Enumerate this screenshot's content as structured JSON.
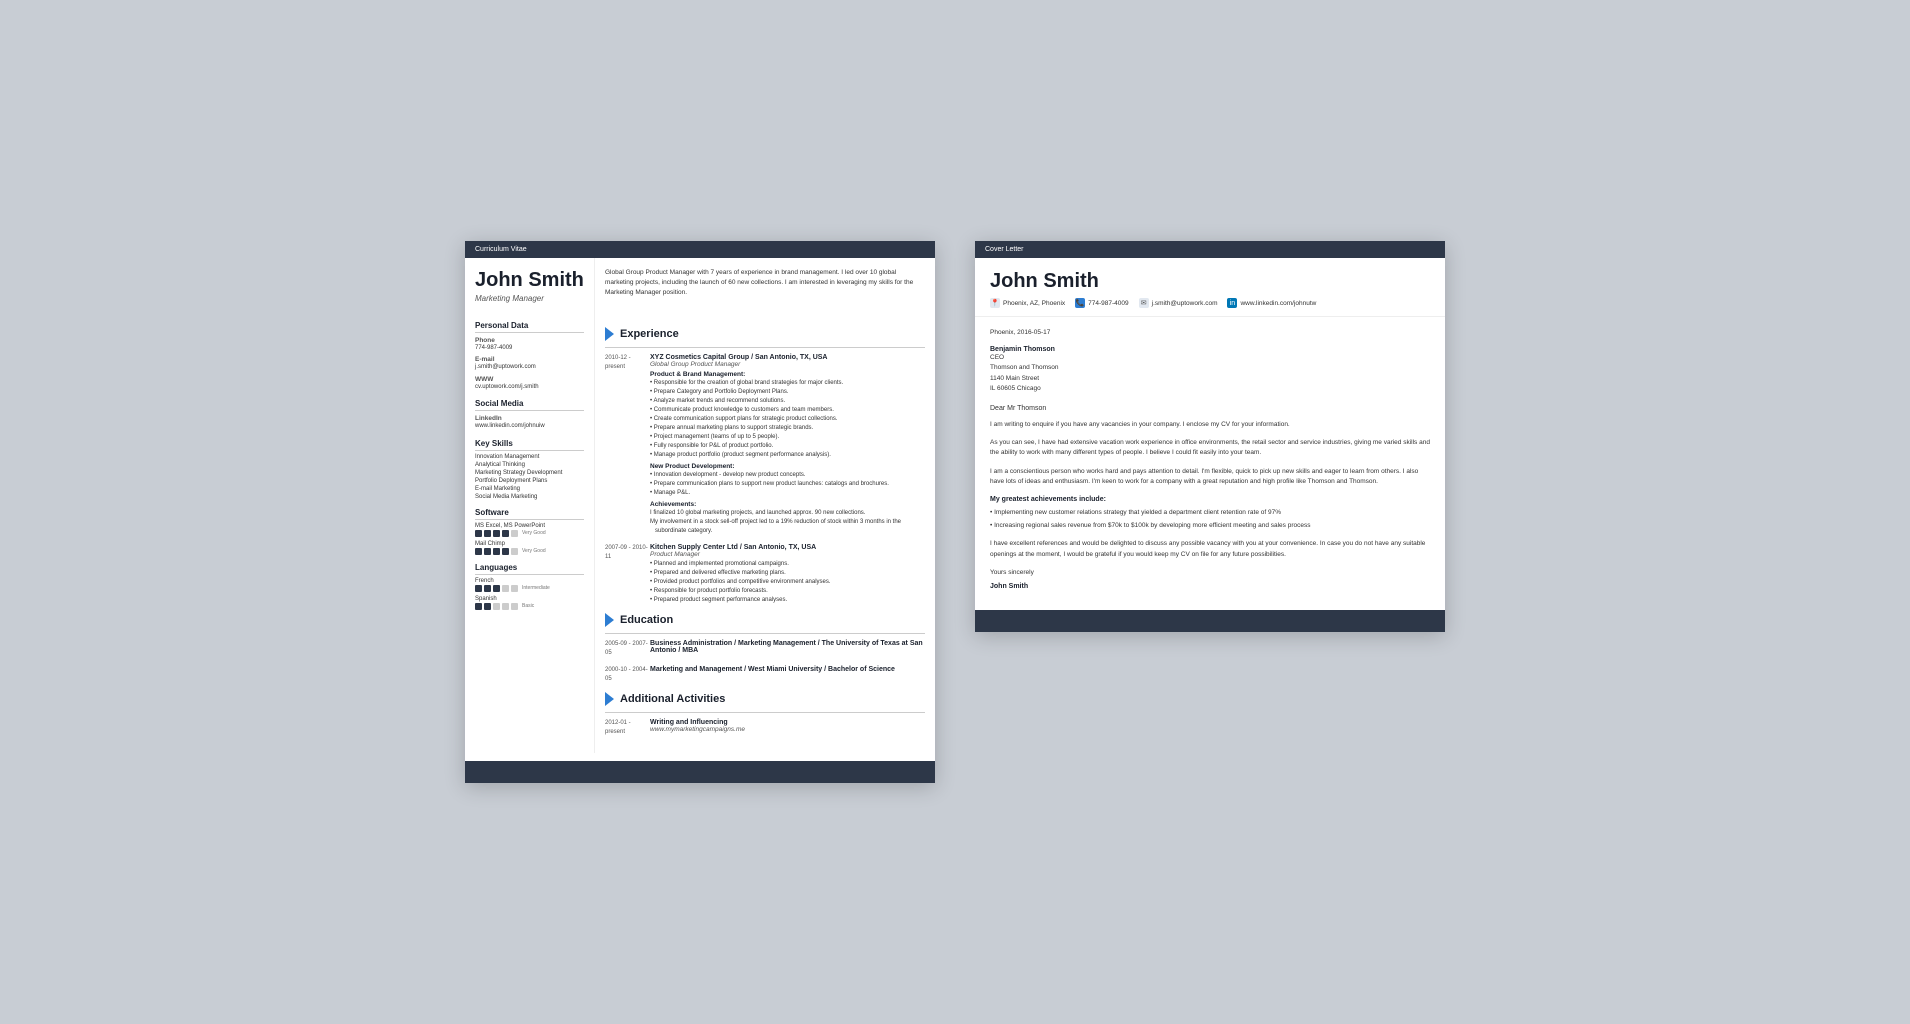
{
  "cv": {
    "header_bar": "Curriculum Vitae",
    "name": "John Smith",
    "title": "Marketing Manager",
    "summary": "Global Group Product Manager with 7 years of experience in brand management. I led over 10 global marketing projects, including the launch of 60 new collections. I am interested in leveraging my skills for the Marketing Manager position.",
    "sections": {
      "personal_data": "Personal Data",
      "phone_label": "Phone",
      "phone": "774-987-4009",
      "email_label": "E-mail",
      "email": "j.smith@uptowork.com",
      "www_label": "WWW",
      "www": "cv.uptowork.com/j.smith",
      "social_media": "Social Media",
      "linkedin_label": "LinkedIn",
      "linkedin": "www.linkedin.com/johnuiw",
      "key_skills": "Key Skills",
      "skills": [
        "Innovation Management",
        "Analytical Thinking",
        "Marketing Strategy Development",
        "Portfolio Deployment Plans",
        "E-mail Marketing",
        "Social Media Marketing"
      ],
      "software": "Software",
      "software_items": [
        {
          "name": "MS Excel, MS PowerPoint",
          "level": 4,
          "label": "Very Good"
        },
        {
          "name": "Mail Chimp",
          "level": 4,
          "label": "Very Good"
        }
      ],
      "languages": "Languages",
      "lang_items": [
        {
          "name": "French",
          "level": 3,
          "label": "Intermediate"
        },
        {
          "name": "Spanish",
          "level": 2,
          "label": "Basic"
        }
      ]
    },
    "experience_title": "Experience",
    "experience": [
      {
        "date": "2010-12 - present",
        "company": "XYZ Cosmetics Capital Group / San Antonio, TX, USA",
        "position": "Global Group Product Manager",
        "subsections": [
          {
            "title": "Product & Brand Management:",
            "bullets": [
              "Responsible for the creation of global brand strategies for major clients.",
              "Prepare Category and Portfolio Deployment Plans.",
              "Analyze market trends and recommend solutions.",
              "Communicate product knowledge to customers and team members.",
              "Create communication support plans for strategic product collections.",
              "Prepare annual marketing plans to support strategic brands.",
              "Project management (teams of up to 5 people).",
              "Fully responsible for P&L of product portfolio.",
              "Manage product portfolio (product segment performance analysis)."
            ]
          },
          {
            "title": "New Product Development:",
            "bullets": [
              "Innovation development - develop new product concepts.",
              "Prepare communication plans to support new product launches: catalogs and brochures.",
              "Manage P&L."
            ]
          },
          {
            "title": "Achievements:",
            "bullets": [
              "I finalized 10 global marketing projects, and launched approx. 90 new collections.",
              "My involvement in a stock sell-off project led to a 19% reduction of stock within 3 months in the subordinate category."
            ]
          }
        ]
      },
      {
        "date": "2007-09 - 2010-11",
        "company": "Kitchen Supply Center Ltd / San Antonio, TX, USA",
        "position": "Product Manager",
        "subsections": [
          {
            "title": "",
            "bullets": [
              "Planned and implemented promotional campaigns.",
              "Prepared and delivered effective marketing plans.",
              "Provided product portfolios and competitive environment analyses.",
              "Responsible for product portfolio forecasts.",
              "Prepared product segment performance analyses."
            ]
          }
        ]
      }
    ],
    "education_title": "Education",
    "education": [
      {
        "date": "2005-09 - 2007-05",
        "title": "Business Administration / Marketing Management / The University of Texas at San Antonio / MBA"
      },
      {
        "date": "2000-10 - 2004-05",
        "title": "Marketing and Management / West Miami University / Bachelor of Science"
      }
    ],
    "activities_title": "Additional Activities",
    "activities": [
      {
        "date": "2012-01 - present",
        "title": "Writing and Influencing",
        "detail": "www.mymarketingcampaigns.me"
      }
    ]
  },
  "cover_letter": {
    "header_bar": "Cover Letter",
    "name": "John Smith",
    "contact": {
      "location": "Phoenix, AZ, Phoenix",
      "phone": "774-987-4009",
      "email": "j.smith@uptowork.com",
      "linkedin": "www.linkedin.com/johnutw"
    },
    "date": "Phoenix, 2016-05-17",
    "recipient": {
      "name": "Benjamin Thomson",
      "title": "CEO",
      "company": "Thomson and Thomson",
      "address": "1140 Main Street",
      "city": "IL 60605 Chicago"
    },
    "salutation": "Dear Mr Thomson",
    "paragraphs": [
      "I am writing to enquire if you have any vacancies in your company. I enclose my CV for your information.",
      "As you can see, I have had extensive vacation work experience in office environments, the retail sector and service industries, giving me varied skills and the ability to work with many different types of people. I believe I could fit easily into your team.",
      "I am a conscientious person who works hard and pays attention to detail. I'm flexible, quick to pick up new skills and eager to learn from others. I also have lots of ideas and enthusiasm. I'm keen to work for a company with a great reputation and high profile like Thomson and Thomson."
    ],
    "achievements_title": "My greatest achievements include:",
    "achievements": [
      "Implementing new customer relations strategy that yielded a department client retention rate of 97%",
      "Increasing regional sales revenue from $70k to $100k by developing more efficient meeting and sales process"
    ],
    "closing_para": "I have excellent references and would be delighted to discuss any possible vacancy with you at your convenience. In case you do not have any suitable openings at the moment, I would be grateful if you would keep my CV on file for any future possibilities.",
    "closing": "Yours sincerely",
    "signature": "John Smith"
  }
}
